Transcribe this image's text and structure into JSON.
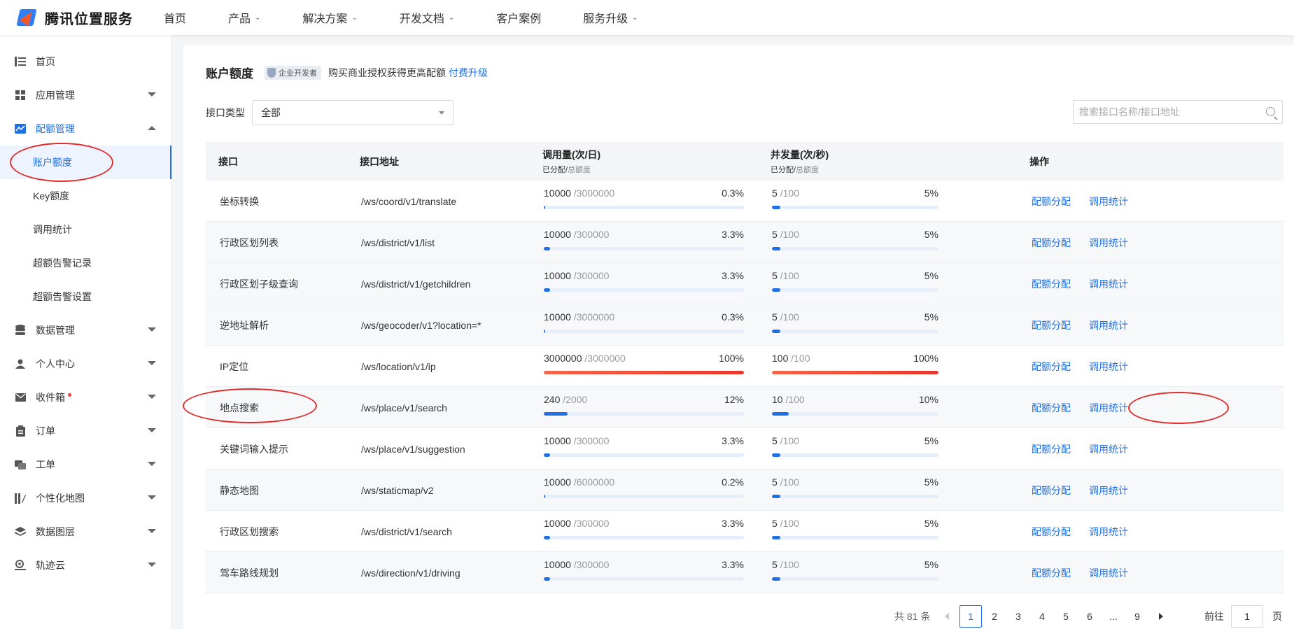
{
  "brand": {
    "name": "腾讯位置服务"
  },
  "topnav": [
    {
      "label": "首页",
      "has_menu": false
    },
    {
      "label": "产品",
      "has_menu": true
    },
    {
      "label": "解决方案",
      "has_menu": true
    },
    {
      "label": "开发文档",
      "has_menu": true
    },
    {
      "label": "客户案例",
      "has_menu": false
    },
    {
      "label": "服务升级",
      "has_menu": true
    }
  ],
  "sidebar": {
    "items": [
      {
        "label": "首页",
        "icon": "home-list-icon"
      },
      {
        "label": "应用管理",
        "icon": "grid-icon"
      },
      {
        "label": "配额管理",
        "icon": "chart-icon"
      },
      {
        "label": "数据管理",
        "icon": "database-icon"
      },
      {
        "label": "个人中心",
        "icon": "user-icon"
      },
      {
        "label": "收件箱",
        "icon": "mail-icon"
      },
      {
        "label": "订单",
        "icon": "clipboard-icon"
      },
      {
        "label": "工单",
        "icon": "ticket-icon"
      },
      {
        "label": "个性化地图",
        "icon": "map-style-icon"
      },
      {
        "label": "数据图层",
        "icon": "layers-icon"
      },
      {
        "label": "轨迹云",
        "icon": "track-icon"
      }
    ],
    "sub_items": [
      "账户额度",
      "Key额度",
      "调用统计",
      "超额告警记录",
      "超额告警设置"
    ]
  },
  "page": {
    "title": "账户额度",
    "badge": "企业开发者",
    "promo_text": "购买商业授权获得更高配额",
    "promo_link": "付费升级",
    "filter_label": "接口类型",
    "filter_value": "全部",
    "search_placeholder": "搜索接口名称/接口地址"
  },
  "table": {
    "headers": {
      "api": "接口",
      "url": "接口地址",
      "calls": "调用量(次/日)",
      "concurrency": "并发量(次/秒)",
      "sub_allocated": "已分配",
      "sub_sep": "/",
      "sub_total": "总额度",
      "actions": "操作"
    },
    "rows": [
      {
        "name": "坐标转换",
        "url": "/ws/coord/v1/translate",
        "calls_used": "10000",
        "calls_total": "/3000000",
        "calls_pct": "0.3%",
        "calls_ratio": 0.003,
        "conc_used": "5",
        "conc_total": "/100",
        "conc_pct": "5%",
        "conc_ratio": 0.05,
        "act1": "配额分配",
        "act2": "调用统计"
      },
      {
        "name": "行政区划列表",
        "url": "/ws/district/v1/list",
        "calls_used": "10000",
        "calls_total": "/300000",
        "calls_pct": "3.3%",
        "calls_ratio": 0.033,
        "conc_used": "5",
        "conc_total": "/100",
        "conc_pct": "5%",
        "conc_ratio": 0.05,
        "act1": "配额分配",
        "act2": "调用统计"
      },
      {
        "name": "行政区划子级查询",
        "url": "/ws/district/v1/getchildren",
        "calls_used": "10000",
        "calls_total": "/300000",
        "calls_pct": "3.3%",
        "calls_ratio": 0.033,
        "conc_used": "5",
        "conc_total": "/100",
        "conc_pct": "5%",
        "conc_ratio": 0.05,
        "act1": "配额分配",
        "act2": "调用统计"
      },
      {
        "name": "逆地址解析",
        "url": "/ws/geocoder/v1?location=*",
        "calls_used": "10000",
        "calls_total": "/3000000",
        "calls_pct": "0.3%",
        "calls_ratio": 0.003,
        "conc_used": "5",
        "conc_total": "/100",
        "conc_pct": "5%",
        "conc_ratio": 0.05,
        "act1": "配额分配",
        "act2": "调用统计"
      },
      {
        "name": "IP定位",
        "url": "/ws/location/v1/ip",
        "calls_used": "3000000",
        "calls_total": "/3000000",
        "calls_pct": "100%",
        "calls_ratio": 1.0,
        "conc_used": "100",
        "conc_total": "/100",
        "conc_pct": "100%",
        "conc_ratio": 1.0,
        "act1": "配额分配",
        "act2": "调用统计"
      },
      {
        "name": "地点搜索",
        "url": "/ws/place/v1/search",
        "calls_used": "240",
        "calls_total": "/2000",
        "calls_pct": "12%",
        "calls_ratio": 0.12,
        "conc_used": "10",
        "conc_total": "/100",
        "conc_pct": "10%",
        "conc_ratio": 0.1,
        "act1": "配额分配",
        "act2": "调用统计"
      },
      {
        "name": "关键词输入提示",
        "url": "/ws/place/v1/suggestion",
        "calls_used": "10000",
        "calls_total": "/300000",
        "calls_pct": "3.3%",
        "calls_ratio": 0.033,
        "conc_used": "5",
        "conc_total": "/100",
        "conc_pct": "5%",
        "conc_ratio": 0.05,
        "act1": "配额分配",
        "act2": "调用统计"
      },
      {
        "name": "静态地图",
        "url": "/ws/staticmap/v2",
        "calls_used": "10000",
        "calls_total": "/6000000",
        "calls_pct": "0.2%",
        "calls_ratio": 0.002,
        "conc_used": "5",
        "conc_total": "/100",
        "conc_pct": "5%",
        "conc_ratio": 0.05,
        "act1": "配额分配",
        "act2": "调用统计"
      },
      {
        "name": "行政区划搜索",
        "url": "/ws/district/v1/search",
        "calls_used": "10000",
        "calls_total": "/300000",
        "calls_pct": "3.3%",
        "calls_ratio": 0.033,
        "conc_used": "5",
        "conc_total": "/100",
        "conc_pct": "5%",
        "conc_ratio": 0.05,
        "act1": "配额分配",
        "act2": "调用统计"
      },
      {
        "name": "驾车路线规划",
        "url": "/ws/direction/v1/driving",
        "calls_used": "10000",
        "calls_total": "/300000",
        "calls_pct": "3.3%",
        "calls_ratio": 0.033,
        "conc_used": "5",
        "conc_total": "/100",
        "conc_pct": "5%",
        "conc_ratio": 0.05,
        "act1": "配额分配",
        "act2": "调用统计"
      }
    ]
  },
  "pagination": {
    "total": "共 81 条",
    "pages": [
      "1",
      "2",
      "3",
      "4",
      "5",
      "6",
      "...",
      "9"
    ],
    "current": "1",
    "goto_label": "前往",
    "goto_value": "1",
    "page_suffix": "页"
  },
  "colors": {
    "accent": "#1f6fe5",
    "danger": "#e8362b",
    "annotation": "#e02b2b"
  }
}
